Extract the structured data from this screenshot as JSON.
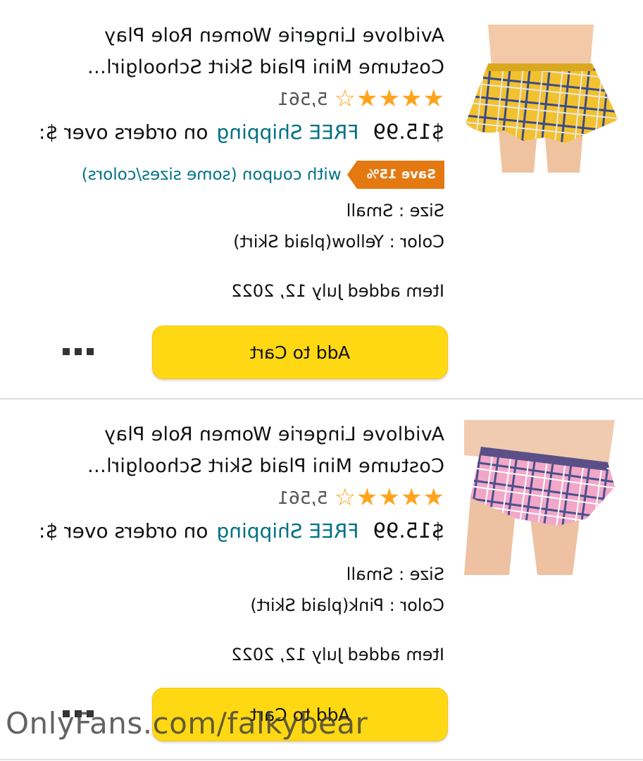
{
  "items": [
    {
      "title_line1": "Avidlove Lingerie Women Role Play",
      "title_line2": "Costume Mini Plaid Skirt Schoolgirl…",
      "rating_count": "5,561",
      "price": "$15.99",
      "shipping_label": "FREE Shipping",
      "shipping_suffix": "on orders over $:",
      "coupon_badge": "Save 15%",
      "coupon_text": "with coupon (some sizes/colors)",
      "size": "Size : Small",
      "color": "Color : Yellow(plaid Skirt)",
      "added": "Item added July 12, 2022",
      "cart_label": "Add to Cart",
      "image": "yellow-plaid-skirt-photo",
      "plaid_color": "#f2c12e"
    },
    {
      "title_line1": "Avidlove Lingerie Women Role Play",
      "title_line2": "Costume Mini Plaid Skirt Schoolgirl…",
      "rating_count": "5,561",
      "price": "$15.99",
      "shipping_label": "FREE Shipping",
      "shipping_suffix": "on orders over $:",
      "size": "Size : Small",
      "color": "Color : Pink(plaid Skirt)",
      "added": "Item added July 12, 2022",
      "cart_label": "Add to Cart",
      "image": "pink-plaid-skirt-photo",
      "plaid_color": "#f2a7c8"
    }
  ],
  "rating_stars": 4,
  "icons": [
    "star-icon",
    "more-options-icon"
  ],
  "colors": {
    "accent_link": "#007185",
    "cart_button": "#ffd814",
    "coupon_badge": "#e47911",
    "star": "#ffa41c"
  },
  "watermark": "OnlyFans.com/falkybear"
}
